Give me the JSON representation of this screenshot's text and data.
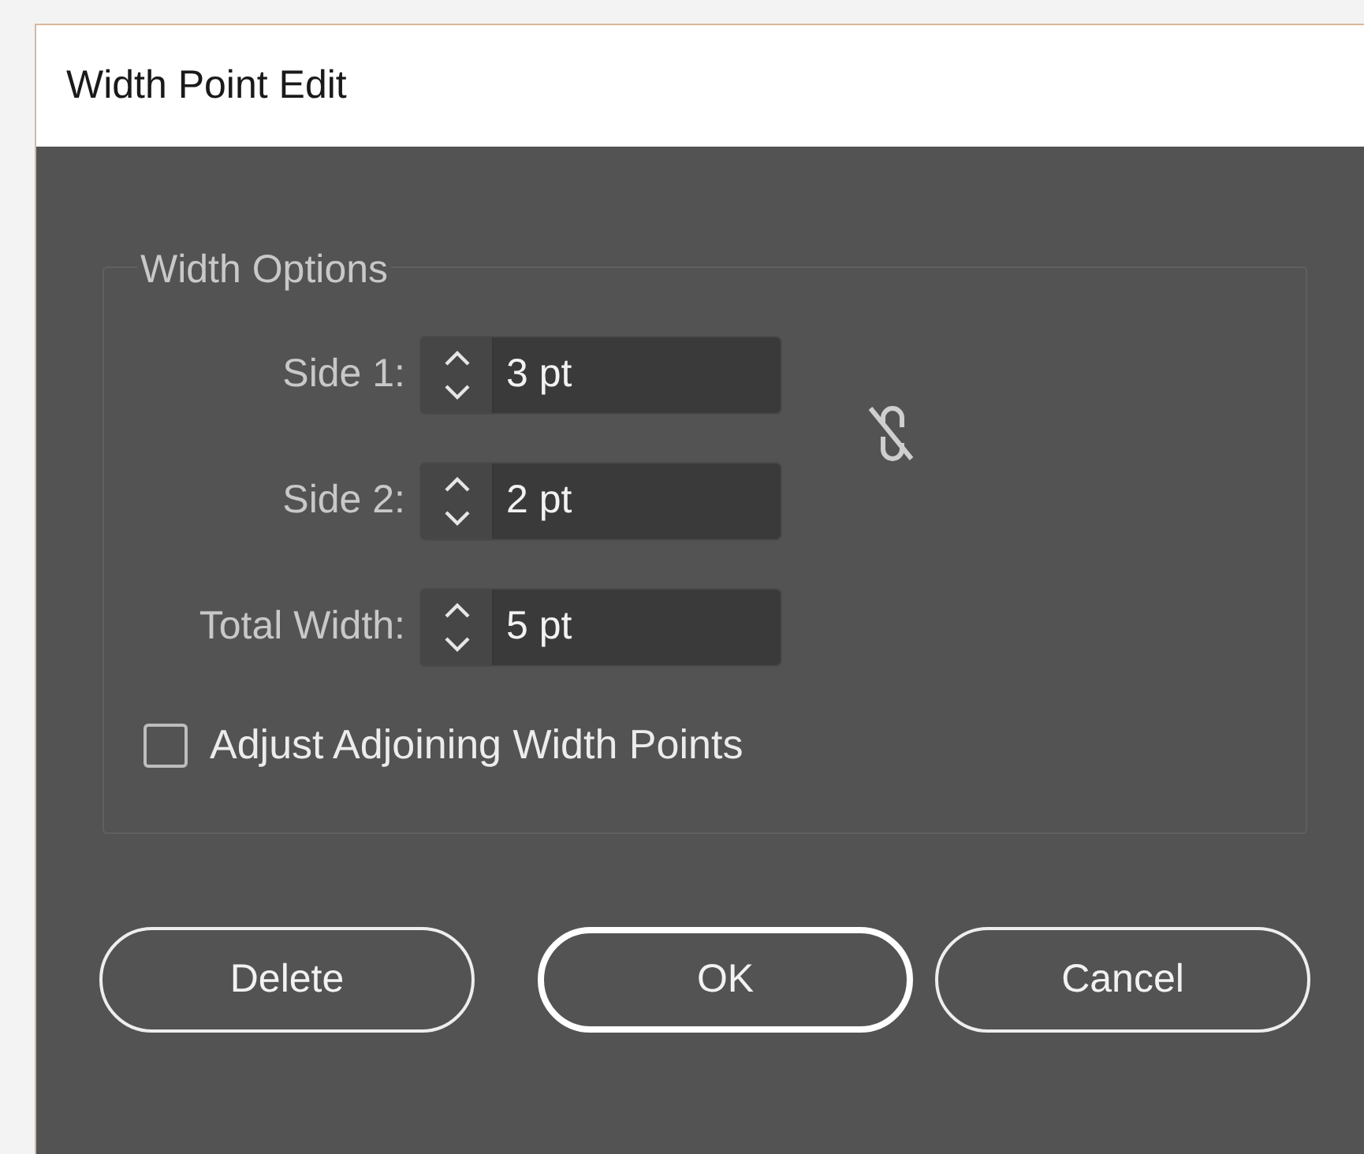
{
  "window": {
    "title": "Width Point Edit"
  },
  "group": {
    "title": "Width Options",
    "fields": [
      {
        "label": "Side 1:",
        "value": "3 pt"
      },
      {
        "label": "Side 2:",
        "value": "2 pt"
      },
      {
        "label": "Total Width:",
        "value": "5 pt"
      }
    ],
    "sides_linked": false,
    "checkbox": {
      "label": "Adjust Adjoining Width Points",
      "checked": false
    }
  },
  "buttons": [
    {
      "label": "Delete",
      "default": false
    },
    {
      "label": "OK",
      "default": true
    },
    {
      "label": "Cancel",
      "default": false
    }
  ]
}
